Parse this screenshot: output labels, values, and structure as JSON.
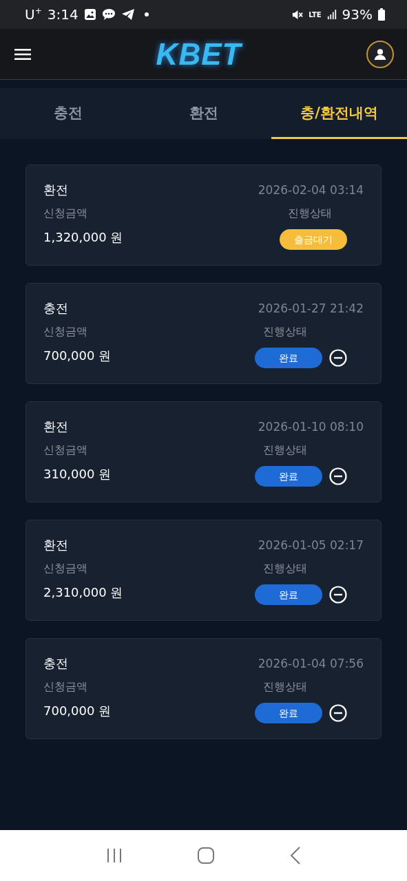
{
  "status_bar": {
    "carrier": "U$^{+}$",
    "time": "3:14",
    "network": "LTE",
    "battery": "93%"
  },
  "header": {
    "logo": "KBET"
  },
  "tabs": [
    {
      "label": "충전",
      "selected": false
    },
    {
      "label": "환전",
      "selected": false
    },
    {
      "label": "충/환전내역",
      "selected": true
    }
  ],
  "records": [
    {
      "type": "환전",
      "date": "2026-02-04 03:14",
      "amount_label": "신청금액",
      "amount": "1,320,000 원",
      "status_label": "진행상태",
      "status": "출금대기",
      "kind": "pending",
      "removable": false
    },
    {
      "type": "충전",
      "date": "2026-01-27 21:42",
      "amount_label": "신청금액",
      "amount": "700,000 원",
      "status_label": "진행상태",
      "status": "완료",
      "kind": "done",
      "removable": true
    },
    {
      "type": "환전",
      "date": "2026-01-10 08:10",
      "amount_label": "신청금액",
      "amount": "310,000 원",
      "status_label": "진행상태",
      "status": "완료",
      "kind": "done",
      "removable": true
    },
    {
      "type": "환전",
      "date": "2026-01-05 02:17",
      "amount_label": "신청금액",
      "amount": "2,310,000 원",
      "status_label": "진행상태",
      "status": "완료",
      "kind": "done",
      "removable": true
    },
    {
      "type": "충전",
      "date": "2026-01-04 07:56",
      "amount_label": "신청금액",
      "amount": "700,000 원",
      "status_label": "진행상태",
      "status": "완료",
      "kind": "done",
      "removable": true
    }
  ]
}
